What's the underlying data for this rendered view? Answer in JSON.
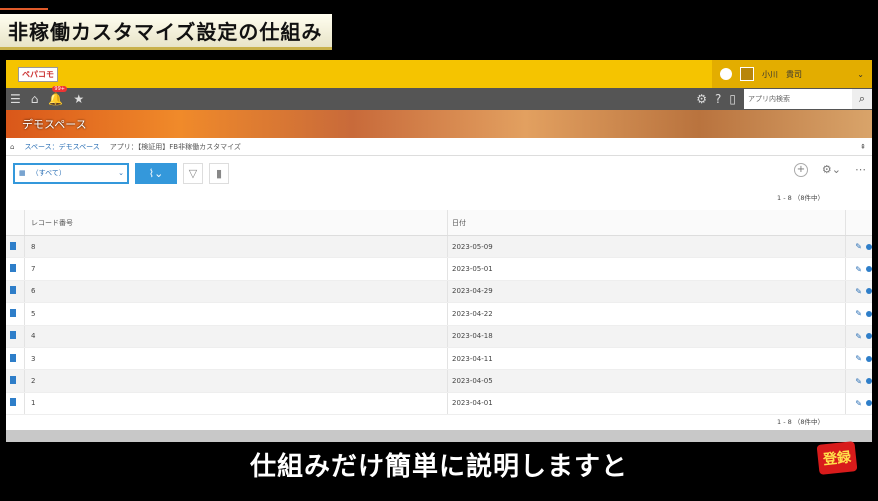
{
  "overlay": {
    "title": "非稼働カスタマイズ設定の仕組み",
    "subtitle": "仕組みだけ簡単に説明しますと",
    "subscribe_label": "登録"
  },
  "app": {
    "logo": "ペパコモ",
    "user_badge": "",
    "user_name": "小川　貴司",
    "notification_count": "99+"
  },
  "search": {
    "placeholder": "アプリ内検索"
  },
  "space": {
    "title": "デモスペース"
  },
  "breadcrumb": {
    "home": "⌂",
    "space": "スペース：デモスペース",
    "app": "アプリ：【検証用】FB非稼働カスタマイズ",
    "pin": "⇞"
  },
  "toolbar": {
    "view_label": "（すべて）"
  },
  "pagination": {
    "top": "1 - 8 （8件中）",
    "bottom": "1 - 8 （8件中）"
  },
  "table": {
    "headers": [
      "レコード番号",
      "日付"
    ],
    "rows": [
      {
        "id": "8",
        "date": "2023-05-09"
      },
      {
        "id": "7",
        "date": "2023-05-01"
      },
      {
        "id": "6",
        "date": "2023-04-29"
      },
      {
        "id": "5",
        "date": "2023-04-22"
      },
      {
        "id": "4",
        "date": "2023-04-18"
      },
      {
        "id": "3",
        "date": "2023-04-11"
      },
      {
        "id": "2",
        "date": "2023-04-05"
      },
      {
        "id": "1",
        "date": "2023-04-01"
      }
    ]
  },
  "colors": {
    "accent": "#3498db",
    "topbar": "#f5c400",
    "subscribe": "#d81b1b"
  }
}
